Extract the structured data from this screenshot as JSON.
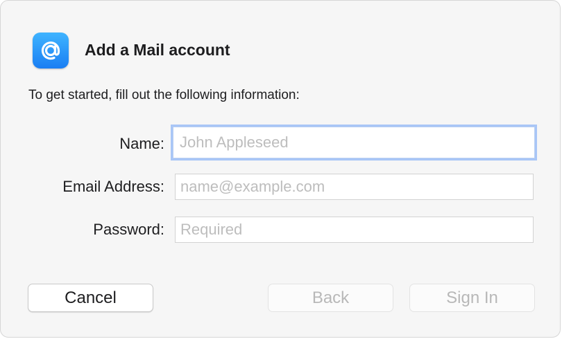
{
  "dialog": {
    "title": "Add a Mail account",
    "intro": "To get started, fill out the following information:",
    "app_icon": "at-sign-icon"
  },
  "form": {
    "name": {
      "label": "Name:",
      "placeholder": "John Appleseed",
      "value": ""
    },
    "email": {
      "label": "Email Address:",
      "placeholder": "name@example.com",
      "value": ""
    },
    "password": {
      "label": "Password:",
      "placeholder": "Required",
      "value": ""
    }
  },
  "buttons": {
    "cancel": "Cancel",
    "back": "Back",
    "sign_in": "Sign In"
  },
  "colors": {
    "icon_gradient_top": "#3fb4ff",
    "icon_gradient_bottom": "#1a7ef3",
    "focus_ring": "#a9c6f7"
  }
}
